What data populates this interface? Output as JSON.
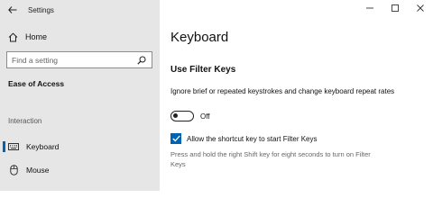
{
  "window": {
    "app_title": "Settings"
  },
  "sidebar": {
    "home_label": "Home",
    "search_placeholder": "Find a setting",
    "section_title": "Ease of Access",
    "group_label": "Interaction",
    "items": [
      {
        "label": "Keyboard",
        "icon": "keyboard-icon",
        "active": true
      },
      {
        "label": "Mouse",
        "icon": "mouse-icon",
        "active": false
      }
    ]
  },
  "main": {
    "page_title": "Keyboard",
    "section_heading": "Use Filter Keys",
    "description": "Ignore brief or repeated keystrokes and change keyboard repeat rates",
    "toggle": {
      "state": "Off",
      "on": false
    },
    "checkbox": {
      "label": "Allow the shortcut key to start Filter Keys",
      "checked": true
    },
    "hint": "Press and hold the right Shift key for eight seconds to turn on Filter Keys"
  },
  "colors": {
    "accent": "#0063b1",
    "sidebar_bg": "#e6e6e6",
    "main_bg": "#ffffff"
  }
}
